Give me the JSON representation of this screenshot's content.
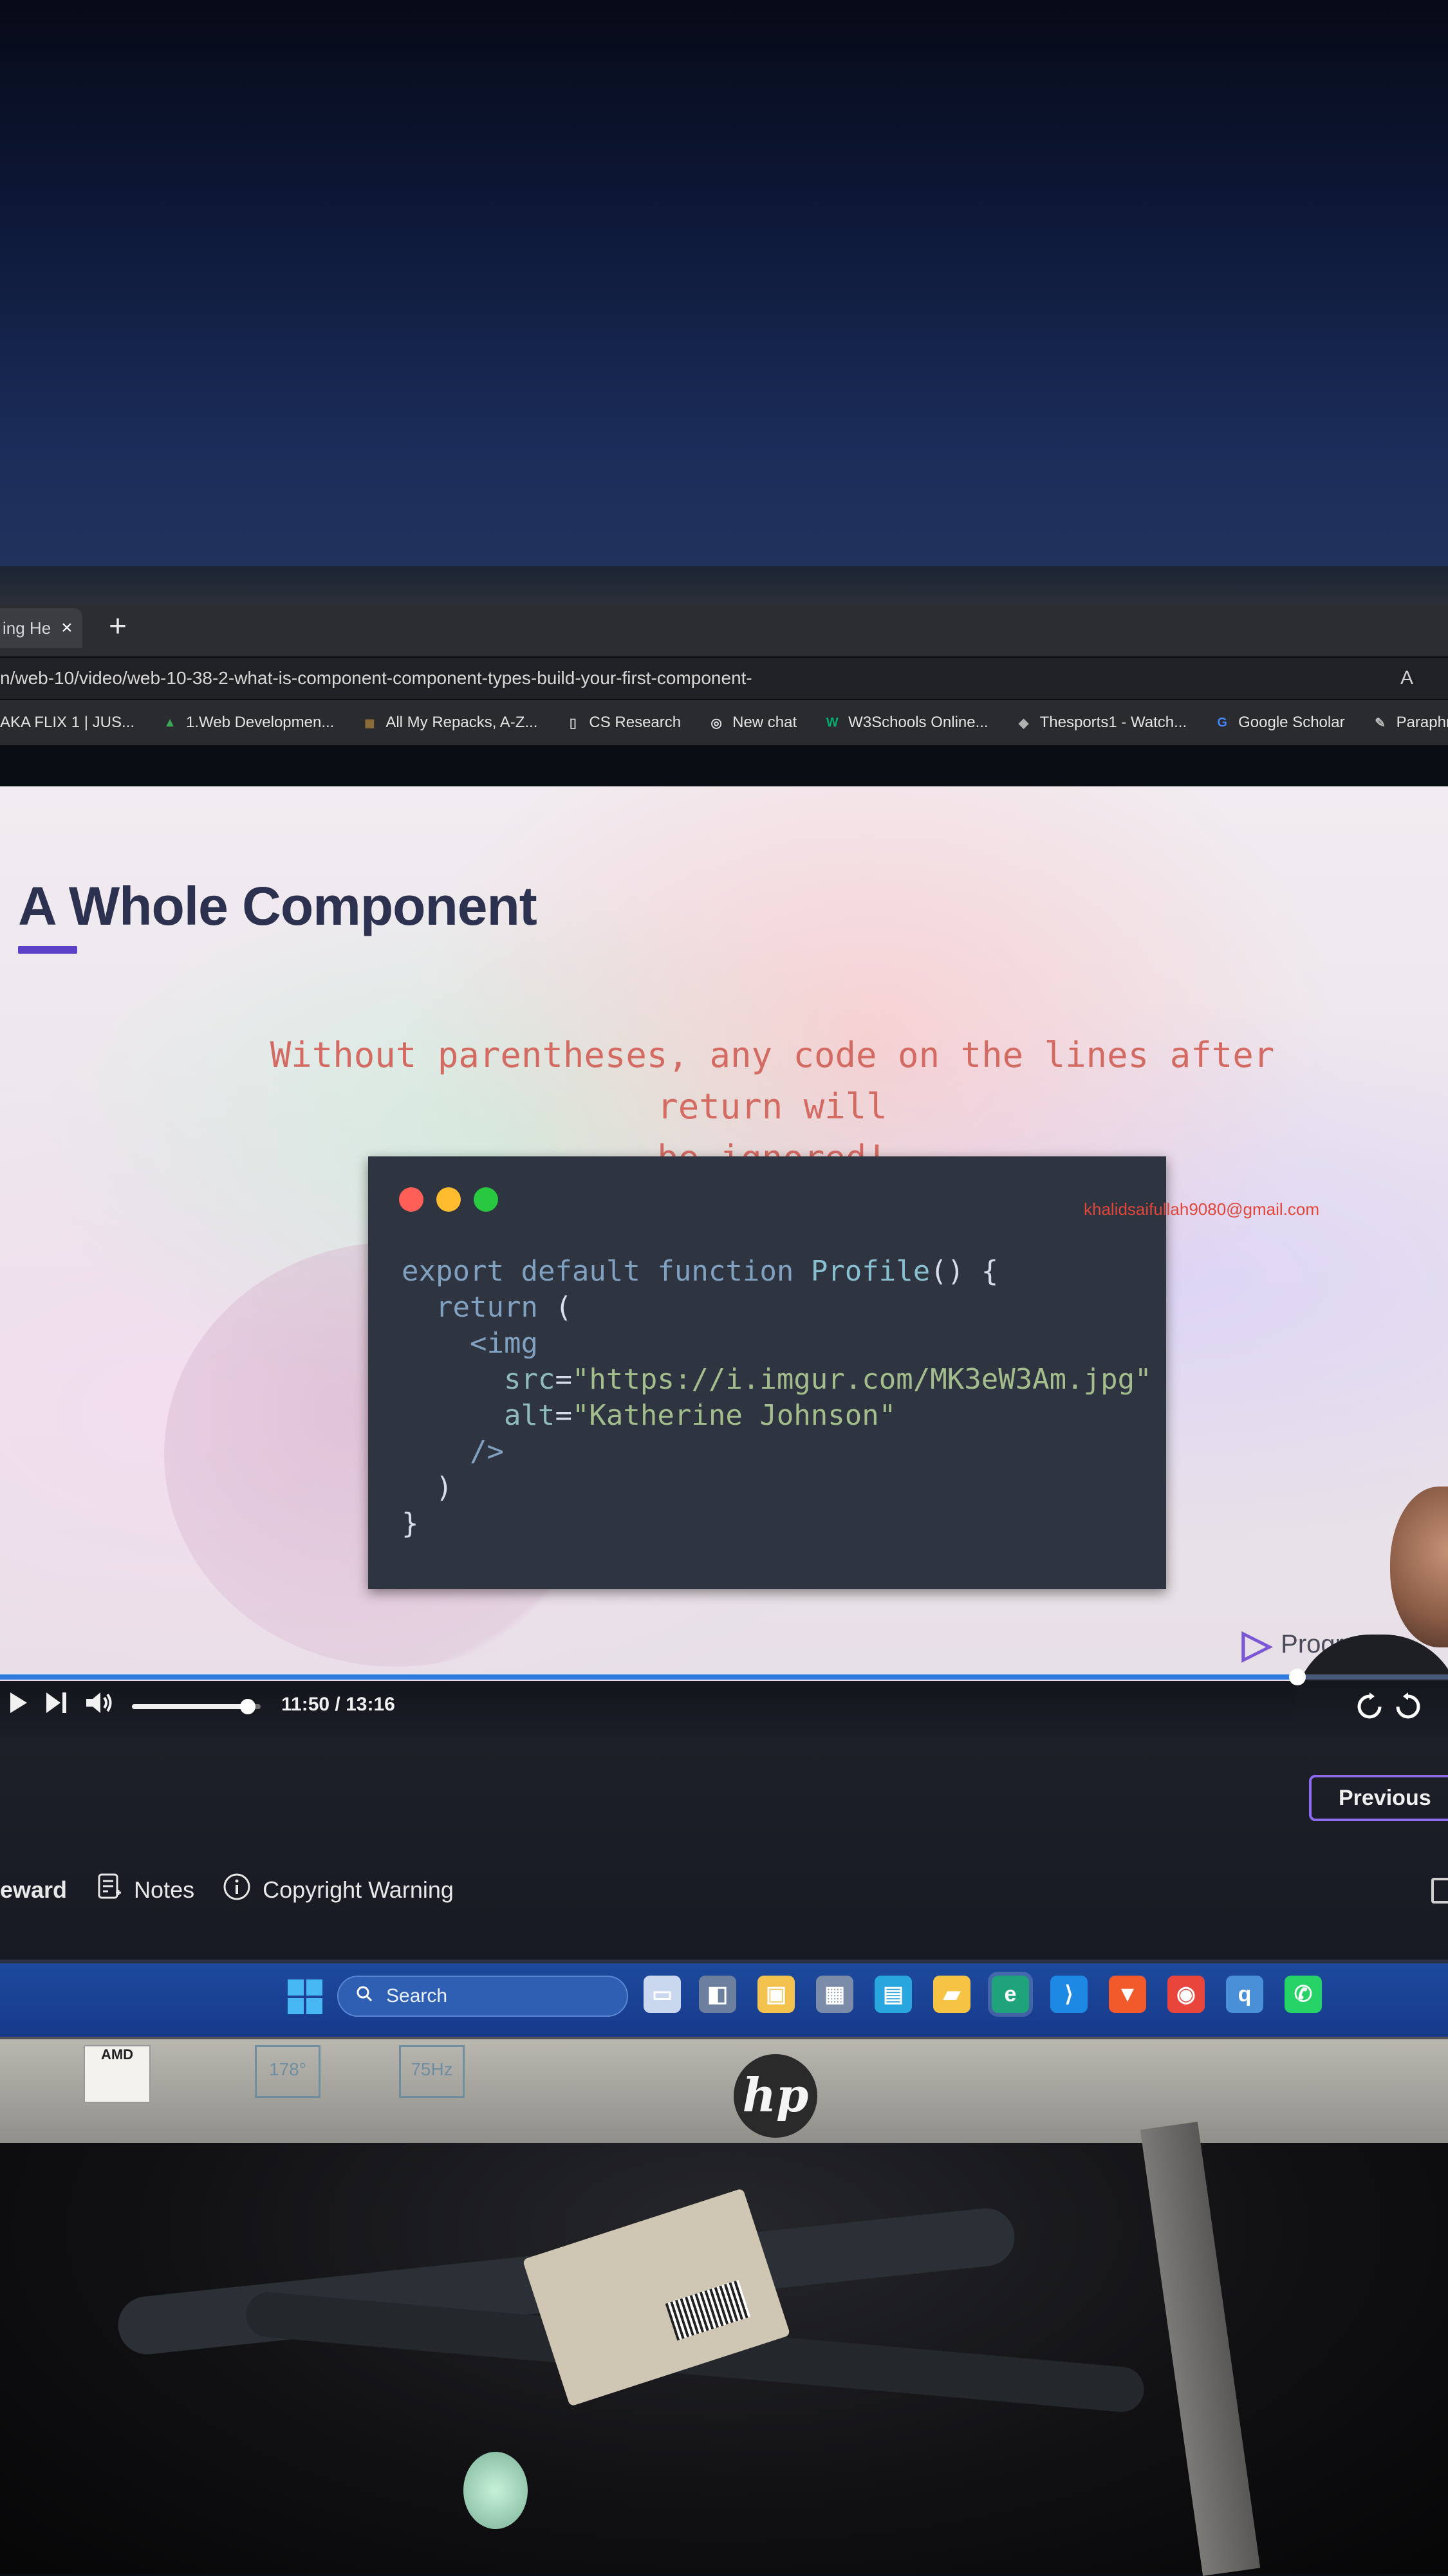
{
  "browser": {
    "tab": {
      "title": "ing He",
      "close_icon": "×"
    },
    "new_tab_icon": "+",
    "address": {
      "url": "n/web-10/video/web-10-38-2-what-is-component-component-types-build-your-first-component-",
      "reader_icon": "A"
    },
    "bookmarks": [
      {
        "label": "AKA FLIX 1 | JUS...",
        "icon": "film-icon",
        "color": "#2a2b2e"
      },
      {
        "label": "1.Web Developmen...",
        "icon": "google-drive-icon",
        "color": "#3aa757"
      },
      {
        "label": "All My Repacks, A-Z...",
        "icon": "repack-icon",
        "color": "#8b6b3a"
      },
      {
        "label": "CS Research",
        "icon": "document-icon",
        "color": "#cfcfcf"
      },
      {
        "label": "New chat",
        "icon": "chatgpt-icon",
        "color": "#dcdcdc"
      },
      {
        "label": "W3Schools Online...",
        "icon": "w3schools-icon",
        "color": "#04aa6d"
      },
      {
        "label": "Thesports1 - Watch...",
        "icon": "sports-icon",
        "color": "#b0b0b0"
      },
      {
        "label": "Google Scholar",
        "icon": "google-icon",
        "color": "#4285f4"
      },
      {
        "label": "Paraphras",
        "icon": "quill-icon",
        "color": "#bdbdbd"
      }
    ]
  },
  "slide": {
    "title": "A Whole Component",
    "callout_line1": "Without parentheses, any code on the lines after return will",
    "callout_line2": "be ignored!",
    "watermark": "khalidsaifullah9080@gmail.com",
    "code_lines": [
      "export default function Profile() {",
      "  return (",
      "    <img",
      "      src=\"https://i.imgur.com/MK3eW3Am.jpg\"",
      "      alt=\"Katherine Johnson\"",
      "    />",
      "  )",
      "}"
    ],
    "brand_text": "Program",
    "accent_color": "#5b3fc4",
    "callout_color": "#d36b63"
  },
  "player": {
    "current_time": "11:50",
    "duration": "13:16",
    "time_label": "11:50 / 13:16",
    "progress_fraction": 0.896,
    "volume_fraction": 0.9,
    "icons": [
      "play-icon",
      "next-icon",
      "volume-icon",
      "replay-10-icon",
      "forward-10-icon"
    ]
  },
  "page": {
    "previous_button": "Previous",
    "tabs": [
      {
        "label": "eward",
        "icon": ""
      },
      {
        "label": "Notes",
        "icon": "notes-icon"
      },
      {
        "label": "Copyright Warning",
        "icon": "info-icon"
      }
    ]
  },
  "taskbar": {
    "search_placeholder": "Search",
    "apps": [
      "file-explorer-widget-icon",
      "task-view-icon",
      "store-icon",
      "calculator-icon",
      "photos-icon",
      "folder-icon",
      "edge-icon",
      "vscode-icon",
      "brave-icon",
      "chrome-icon",
      "qbittorrent-icon",
      "whatsapp-icon"
    ]
  },
  "monitor": {
    "brand": "hp",
    "amd_sticker": "AMD",
    "sticker_a": "178°",
    "sticker_b": "75Hz"
  }
}
